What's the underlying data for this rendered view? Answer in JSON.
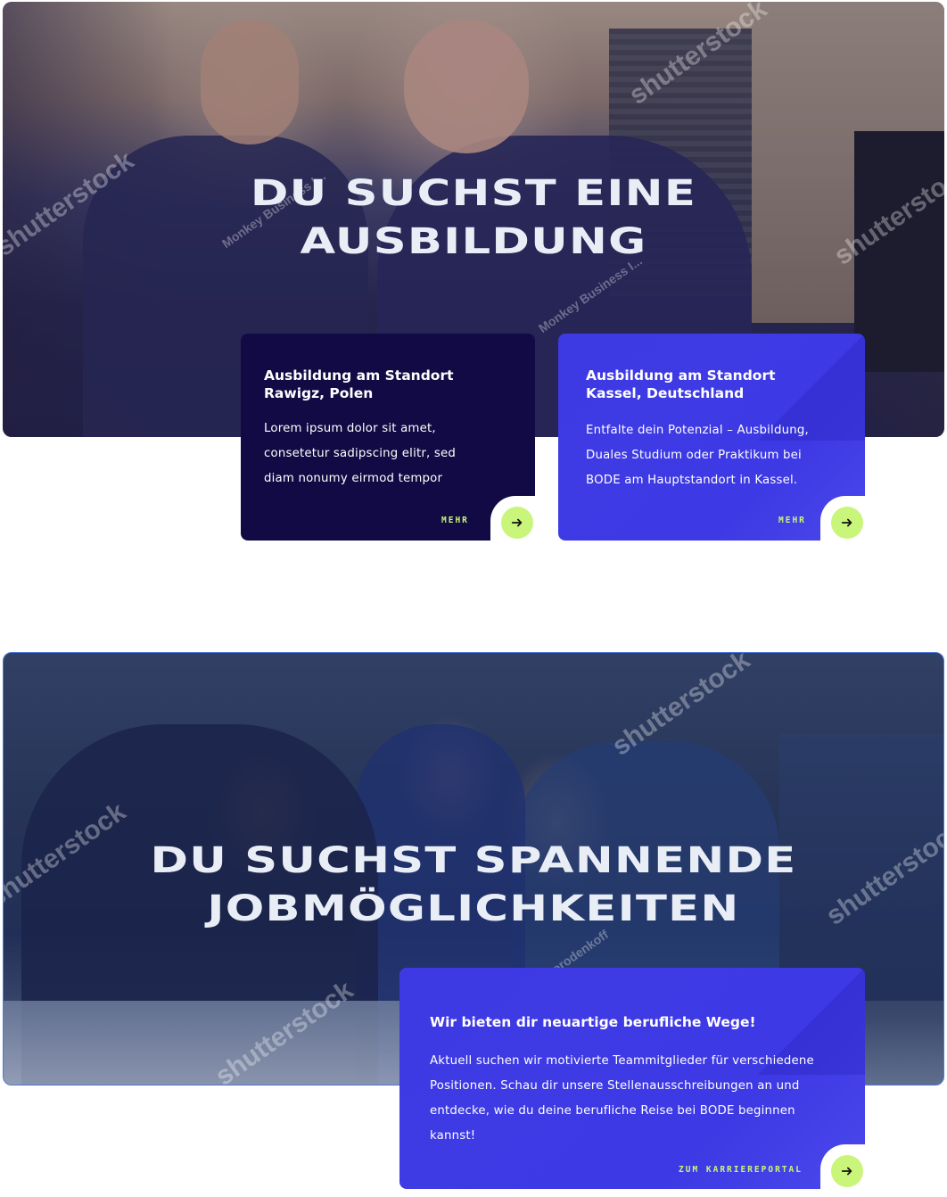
{
  "section_training": {
    "title_line1": "DU SUCHST EINE",
    "title_line2": "AUSBILDUNG",
    "cards": [
      {
        "heading_line1": "Ausbildung am Standort",
        "heading_line2": "Rawigz, Polen",
        "body": [
          "Lorem ipsum dolor sit amet,",
          "consetetur sadipscing elitr, sed",
          "diam nonumy eirmod tempor"
        ],
        "link_label": "MEHR"
      },
      {
        "heading_line1": "Ausbildung am Standort",
        "heading_line2": "Kassel, Deutschland",
        "body": [
          "Entfalte dein Potenzial – Ausbildung,",
          "Duales Studium oder Praktikum bei",
          "BODE am Hauptstandort in Kassel."
        ],
        "link_label": "MEHR"
      }
    ]
  },
  "section_jobs": {
    "title_line1": "DU SUCHST SPANNENDE",
    "title_line2": "JOBMÖGLICHKEITEN",
    "card": {
      "heading": "Wir bieten dir neuartige berufliche Wege!",
      "body": [
        "Aktuell suchen wir motivierte Teammitglieder für verschiedene",
        "Positionen. Schau dir unsere Stellenausschreibungen an und",
        "entdecke, wie du deine berufliche Reise bei BODE beginnen",
        "kannst!"
      ],
      "link_label": "ZUM KARRIEREPORTAL"
    }
  },
  "watermarks": {
    "brand": "shutterstock",
    "photographer_1": "Monkey Business I...",
    "photographer_2": "Gorodenkoff"
  },
  "colors": {
    "card_dark": "#120a44",
    "card_blue": "#3e3ae3",
    "accent_lime": "#c8f57a",
    "title_text": "#e9eef6"
  },
  "icons": {
    "arrow": "arrow-right-icon"
  }
}
